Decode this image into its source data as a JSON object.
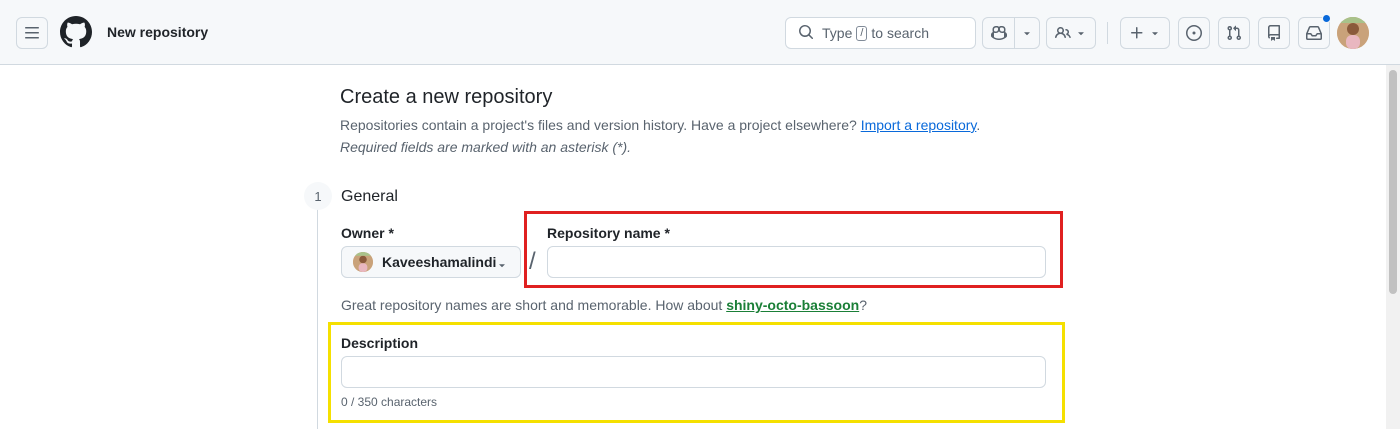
{
  "header": {
    "menu_icon": "hamburger-icon",
    "logo_icon": "github-octocat-icon",
    "context_title": "New repository",
    "search": {
      "prefix": "Type",
      "key": "/",
      "suffix": "to search"
    },
    "actions": [
      "copilot-icon",
      "chevron-down-icon",
      "codespaces-icon",
      "plus-icon",
      "issues-icon",
      "pull-requests-icon",
      "repo-icon",
      "inbox-icon"
    ],
    "notification_dot_color": "#0969da"
  },
  "page": {
    "title": "Create a new repository",
    "lead_text": "Repositories contain a project's files and version history. Have a project elsewhere?",
    "import_link": "Import a repository",
    "lead_end": ".",
    "required_note": "Required fields are marked with an asterisk (*)."
  },
  "general": {
    "step_number": "1",
    "title": "General",
    "owner_label": "Owner *",
    "owner_value": "Kaveeshamalindi",
    "slash": "/",
    "repo_name_label": "Repository name *",
    "repo_name_value": "",
    "hint_prefix": "Great repository names are short and memorable. How about",
    "suggestion": "shiny-octo-bassoon",
    "hint_suffix": "?",
    "description_label": "Description",
    "description_value": "",
    "char_counter": "0 / 350 characters"
  },
  "annotations": {
    "repo_name_highlight_color": "#e02020",
    "description_highlight_color": "#f5e000"
  },
  "colors": {
    "link": "#0969da",
    "suggestion": "#1a7f37",
    "border": "#d1d9e0"
  }
}
